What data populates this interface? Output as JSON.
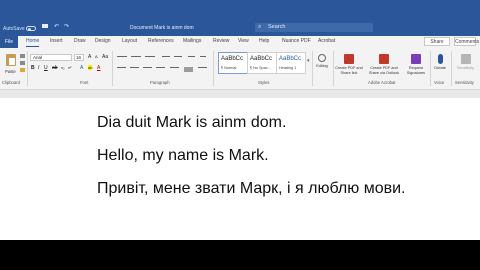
{
  "titlebar": {
    "autosave": "AutoSave",
    "doc_title": "Document Mark is ainm dom",
    "search": "Search"
  },
  "tabs": [
    "File",
    "Home",
    "Insert",
    "Draw",
    "Design",
    "Layout",
    "References",
    "Mailings",
    "Review",
    "View",
    "Help",
    "Nuance PDF",
    "Acrobat"
  ],
  "share": "Share",
  "comments": "Comments",
  "ribbon": {
    "paste": "Paste",
    "font_name": "Arial",
    "font_size": "16",
    "groups": [
      "Clipboard",
      "Font",
      "Paragraph",
      "Styles",
      "Adobe Acrobat",
      "Voice",
      "Sensitivity"
    ],
    "styles": [
      {
        "sample": "AaBbCc",
        "name": "¶ Normal"
      },
      {
        "sample": "AaBbCc",
        "name": "¶ No Spac..."
      },
      {
        "sample": "AaBbCc",
        "name": "Heading 1"
      }
    ],
    "editing": "Editing",
    "acrobat": [
      "Create PDF and Share link",
      "Create PDF and Share via Outlook",
      "Request Signatures"
    ],
    "dictate": "Dictate",
    "sensitivity": "Sensitivity"
  },
  "document": {
    "lines": [
      "Dia duit Mark is ainm dom.",
      "Hello, my name is Mark.",
      "Привіт, мене звати Марк, і я люблю мови."
    ]
  },
  "colors": {
    "accent": "#2b579a",
    "ribbon": "#f3f3f3",
    "page": "#ffffff"
  }
}
